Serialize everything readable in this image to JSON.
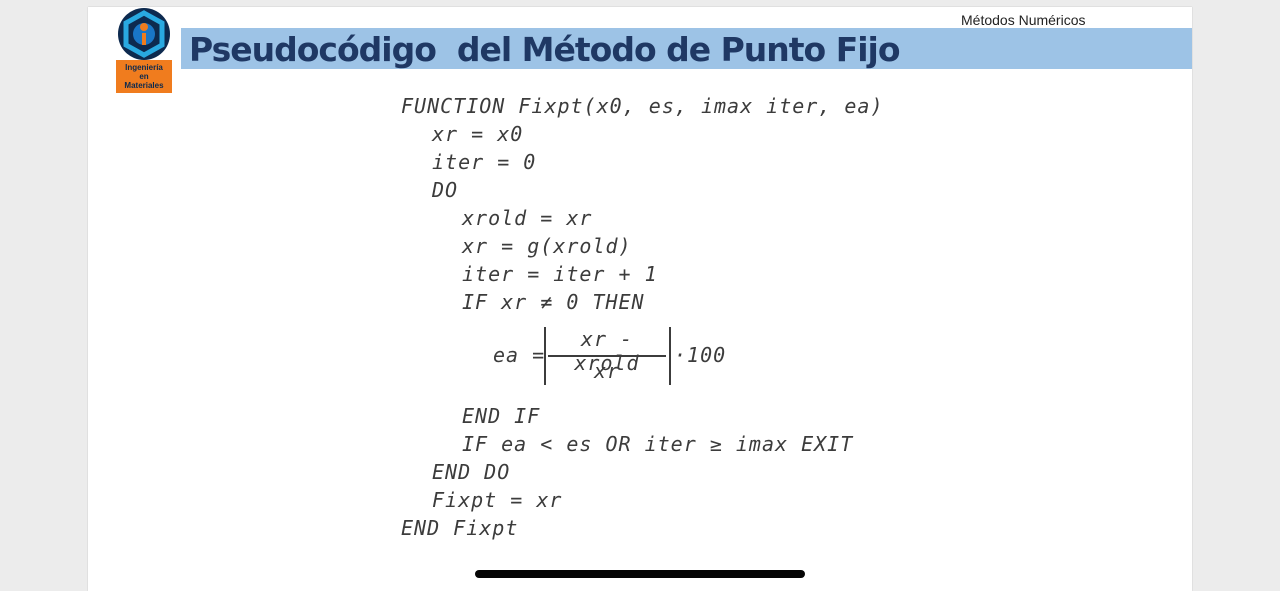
{
  "header": {
    "course": "Métodos Numéricos",
    "title": "Pseudocódigo  del Método de Punto Fijo"
  },
  "logo": {
    "line1": "Ingeniería",
    "line2": "en",
    "line3": "Materiales",
    "colors": {
      "blue": "#1976c7",
      "orange": "#f07c1e",
      "navy": "#0d2a4f"
    }
  },
  "code": {
    "lines": [
      "FUNCTION Fixpt(x0, es, imax iter, ea)",
      "xr = x0",
      "iter = 0",
      "DO",
      "xrold = xr",
      "xr = g(xrold)",
      "iter = iter + 1",
      "IF xr ≠ 0 THEN",
      "END IF",
      "IF ea < es OR iter ≥ imax EXIT",
      "END DO",
      "Fixpt = xr",
      "END Fixpt"
    ],
    "formula": {
      "lhs": "ea =",
      "numerator": "xr - xrold",
      "denominator": "xr",
      "multiplier": "·100"
    }
  },
  "colors": {
    "banner": "#9dc3e6",
    "title": "#1f3864",
    "code": "#3c3c3c"
  }
}
